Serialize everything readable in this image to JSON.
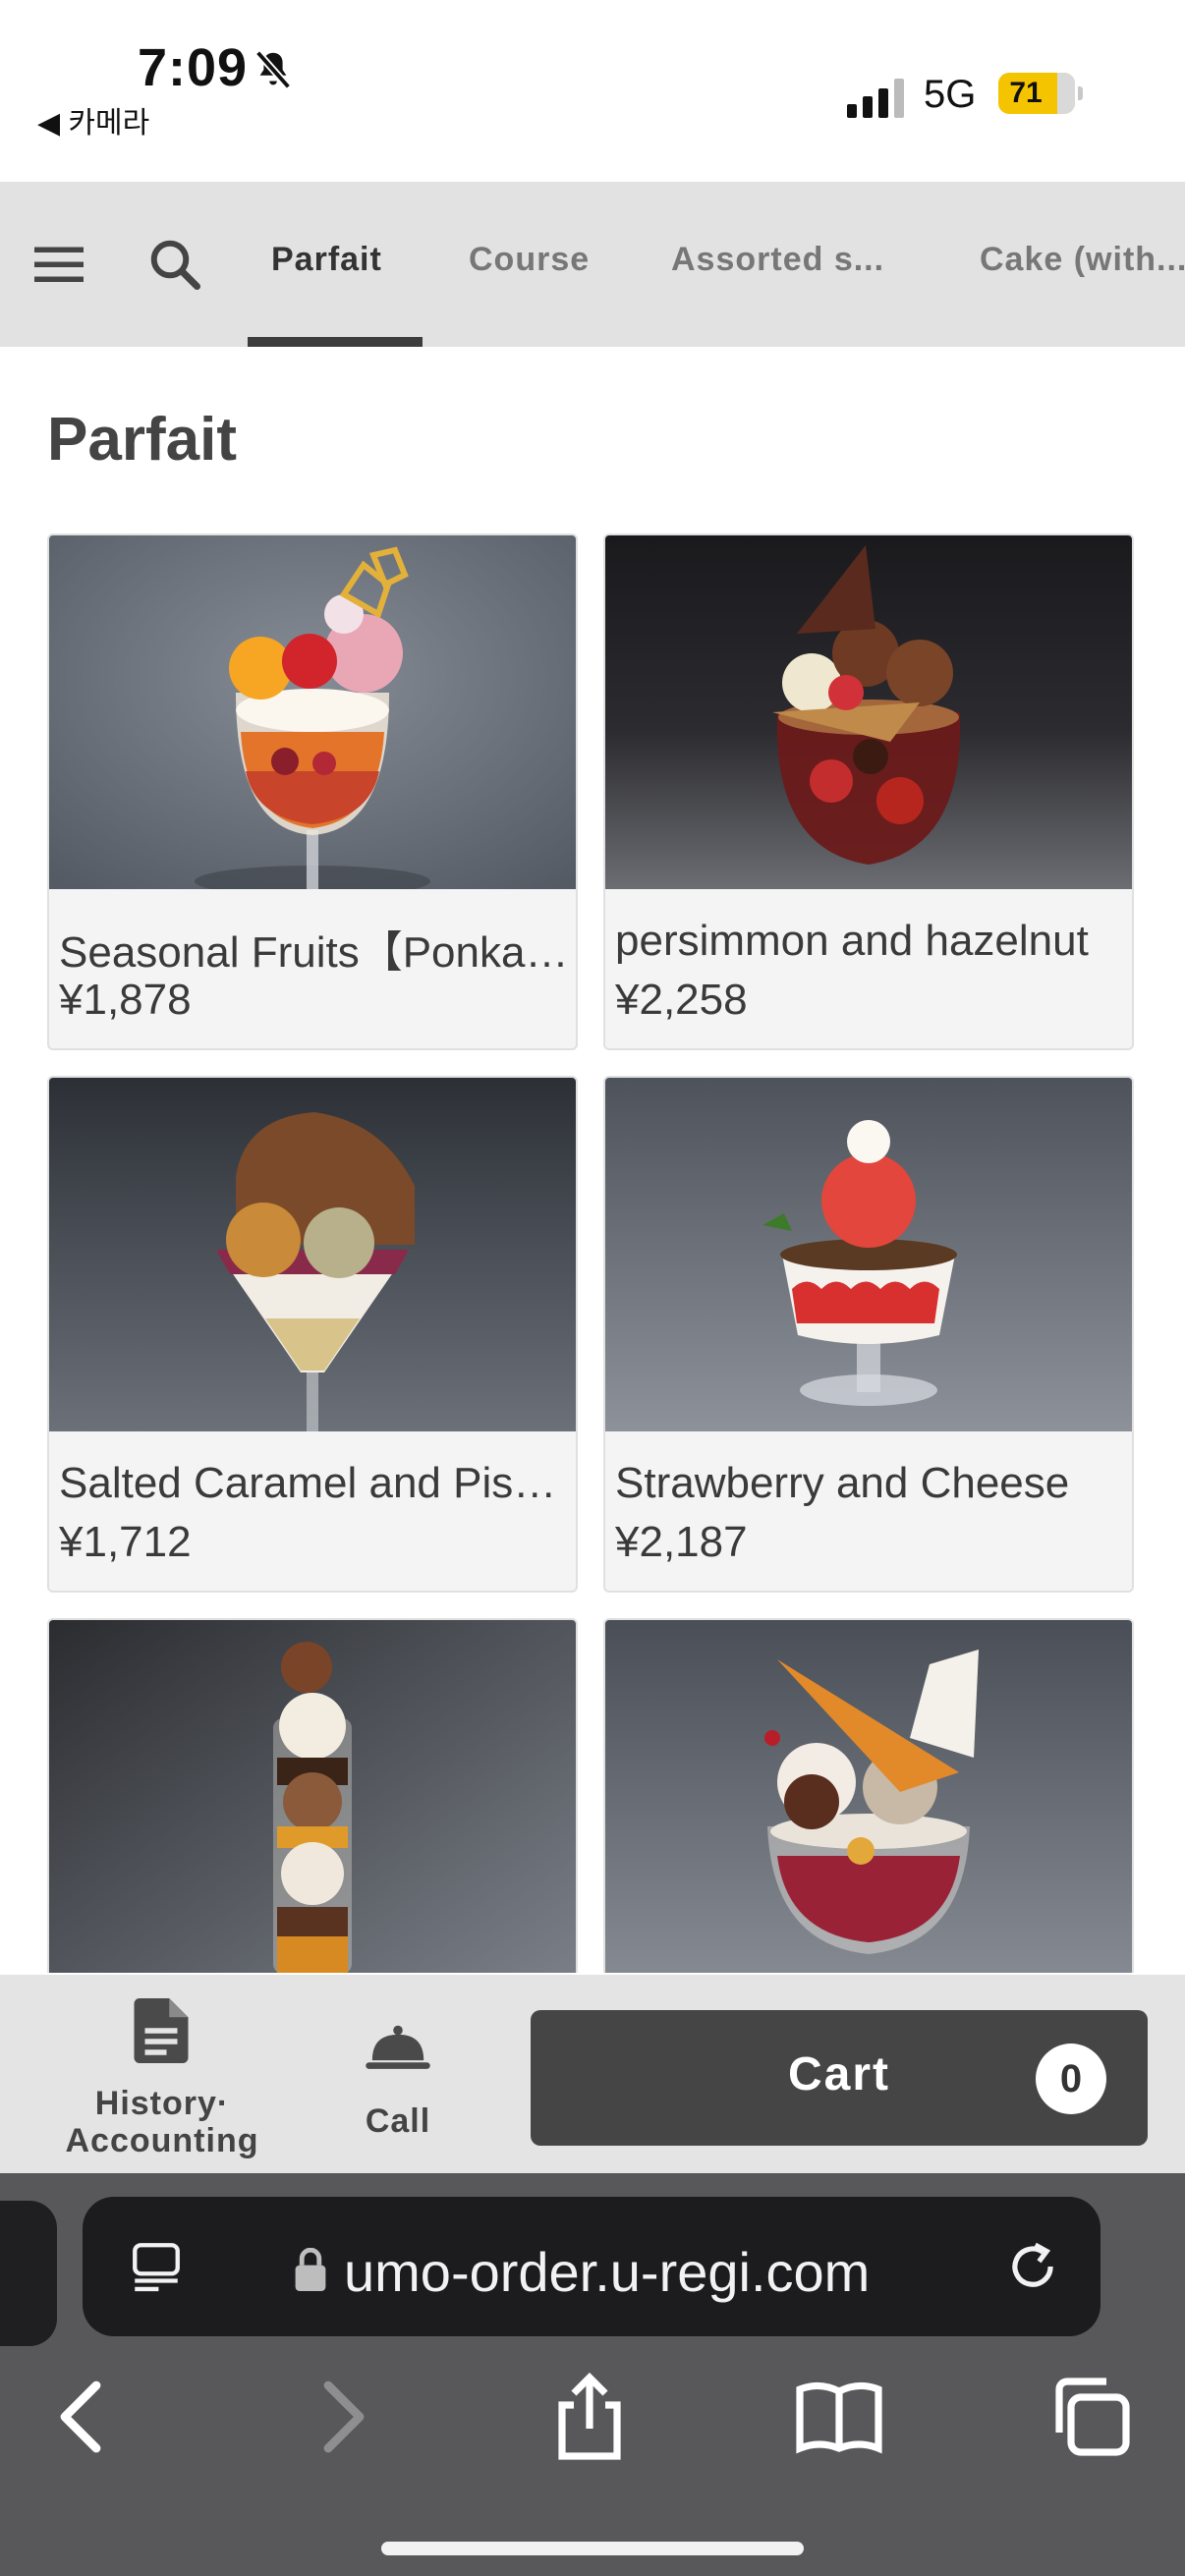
{
  "status_bar": {
    "time": "7:09",
    "back_label": "◀ 카메라",
    "network": "5G",
    "battery": "71"
  },
  "nav": {
    "tabs": [
      {
        "label": "Parfait",
        "active": true
      },
      {
        "label": "Course",
        "active": false
      },
      {
        "label": "Assorted s...",
        "active": false
      },
      {
        "label": "Cake (with...",
        "active": false
      }
    ]
  },
  "section": {
    "title": "Parfait"
  },
  "products": [
    {
      "name": "Seasonal Fruits【Ponka…",
      "price": "¥1,878",
      "image": "seasonal-fruits-parfait"
    },
    {
      "name": "persimmon and hazelnut",
      "price": "¥2,258",
      "image": "persimmon-hazelnut-parfait"
    },
    {
      "name": "Salted Caramel and Pis…",
      "price": "¥1,712",
      "image": "salted-caramel-pistachio-parfait"
    },
    {
      "name": "Strawberry and Cheese",
      "price": "¥2,187",
      "image": "strawberry-cheese-parfait"
    },
    {
      "name": "",
      "price": "",
      "image": "layered-chocolate-parfait"
    },
    {
      "name": "",
      "price": "",
      "image": "berry-wafer-parfait"
    }
  ],
  "action_bar": {
    "history_label_1": "History·",
    "history_label_2": "Accounting",
    "call_label": "Call",
    "cart_label": "Cart",
    "cart_count": "0"
  },
  "browser": {
    "url": "umo-order.u-regi.com"
  },
  "colors": {
    "nav_bg": "#e2e2e2",
    "active_tab_underline": "#3d3d3d",
    "cart_button": "#454545",
    "battery": "#f5c400",
    "safari_bar": "#58585a"
  },
  "icons": [
    "hamburger-menu-icon",
    "search-icon",
    "document-icon",
    "service-bell-icon",
    "tabs-overview-icon",
    "lock-icon",
    "reload-icon",
    "back-icon",
    "forward-icon",
    "share-icon",
    "bookmarks-icon",
    "tabs-icon",
    "bell-slash-icon",
    "cellular-signal-icon"
  ]
}
